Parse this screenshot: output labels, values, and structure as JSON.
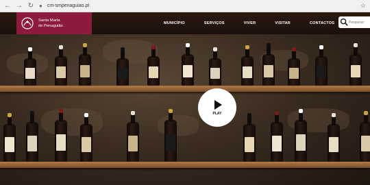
{
  "browser": {
    "back_icon": "arrow-left-icon",
    "forward_icon": "arrow-right-icon",
    "reload_icon": "reload-icon",
    "url": "cm-smpenaguiao.pt",
    "bookmark_icon": "star-icon"
  },
  "header": {
    "logo_line1": "Santa Marta",
    "logo_line2": "de Penaguião",
    "brand_color": "#8c1b3e",
    "nav": [
      "MUNICÍPIO",
      "SERVIÇOS",
      "VIVER",
      "VISITAR",
      "CONTACTOS"
    ],
    "search_placeholder": "Pesquisar"
  },
  "hero": {
    "play_label": "PLAY"
  }
}
